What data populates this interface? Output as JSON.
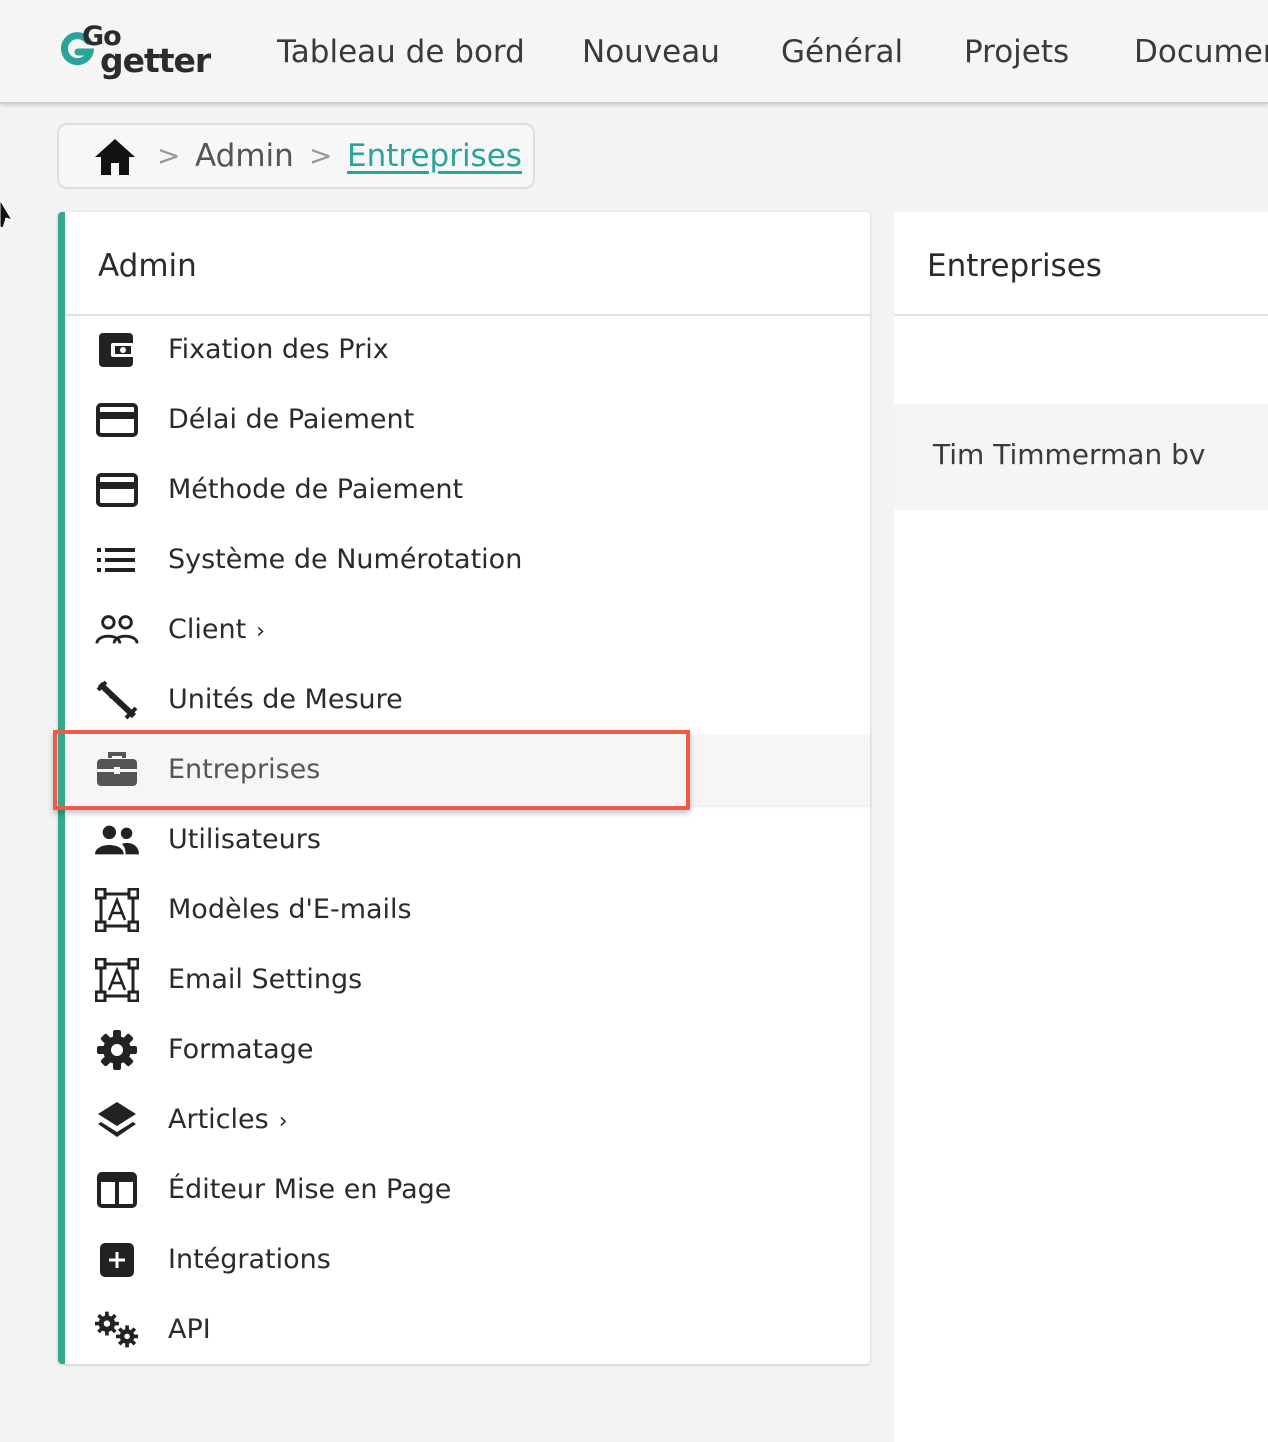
{
  "brand": {
    "logo_top": "Go",
    "logo_bottom": "getter",
    "accent_color": "#35a88d",
    "link_color": "#2aa39a"
  },
  "nav": {
    "items": [
      {
        "label": "Tableau de bord"
      },
      {
        "label": "Nouveau"
      },
      {
        "label": "Général"
      },
      {
        "label": "Projets"
      },
      {
        "label": "Documen"
      }
    ]
  },
  "breadcrumb": {
    "home_icon": "home-icon",
    "separator": ">",
    "items": [
      {
        "label": "Admin"
      },
      {
        "label": "Entreprises"
      }
    ]
  },
  "sidebar": {
    "title": "Admin",
    "items": [
      {
        "label": "Fixation des Prix",
        "icon": "wallet-icon"
      },
      {
        "label": "Délai de Paiement",
        "icon": "credit-card-icon"
      },
      {
        "label": "Méthode de Paiement",
        "icon": "credit-card-icon"
      },
      {
        "label": "Système de Numérotation",
        "icon": "list-icon"
      },
      {
        "label": "Client",
        "icon": "users-outline-icon",
        "has_submenu": true
      },
      {
        "label": "Unités de Mesure",
        "icon": "ruler-icon"
      },
      {
        "label": "Entreprises",
        "icon": "briefcase-icon",
        "active": true
      },
      {
        "label": "Utilisateurs",
        "icon": "users-icon"
      },
      {
        "label": "Modèles d'E-mails",
        "icon": "text-frame-icon"
      },
      {
        "label": "Email Settings",
        "icon": "text-frame-icon"
      },
      {
        "label": "Formatage",
        "icon": "gear-icon"
      },
      {
        "label": "Articles",
        "icon": "layers-icon",
        "has_submenu": true
      },
      {
        "label": "Éditeur Mise en Page",
        "icon": "columns-icon"
      },
      {
        "label": "Intégrations",
        "icon": "plus-square-icon"
      },
      {
        "label": "API",
        "icon": "gears-icon"
      }
    ],
    "submenu_chevron": "›"
  },
  "content": {
    "title": "Entreprises",
    "rows": [
      {
        "name": "Tim Timmerman bv"
      }
    ]
  },
  "annotation": {
    "highlight_color": "#ef5a4b"
  }
}
